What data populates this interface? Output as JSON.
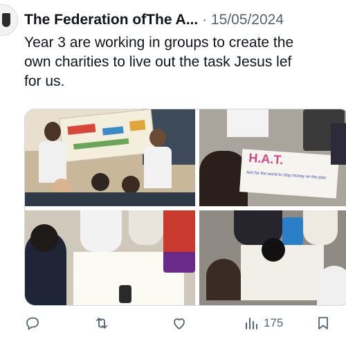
{
  "tweet": {
    "author": "The Federation ofThe A...",
    "separator": "·",
    "date": "15/05/2024",
    "text": "Year 3 are working in groups to create the\nown charities to live out the task Jesus lef\nfor us.",
    "poster_words": [
      "H.A.T.",
      "Aim for the world to stop money on the plan"
    ]
  },
  "actions": {
    "reply_icon": "reply-icon",
    "retweet_icon": "retweet-icon",
    "like_icon": "like-icon",
    "views_icon": "views-icon",
    "views_count": "175",
    "bookmark_icon": "bookmark-icon"
  },
  "colors": {
    "text": "#0f1419",
    "muted": "#536471",
    "border": "#cfd9de"
  }
}
